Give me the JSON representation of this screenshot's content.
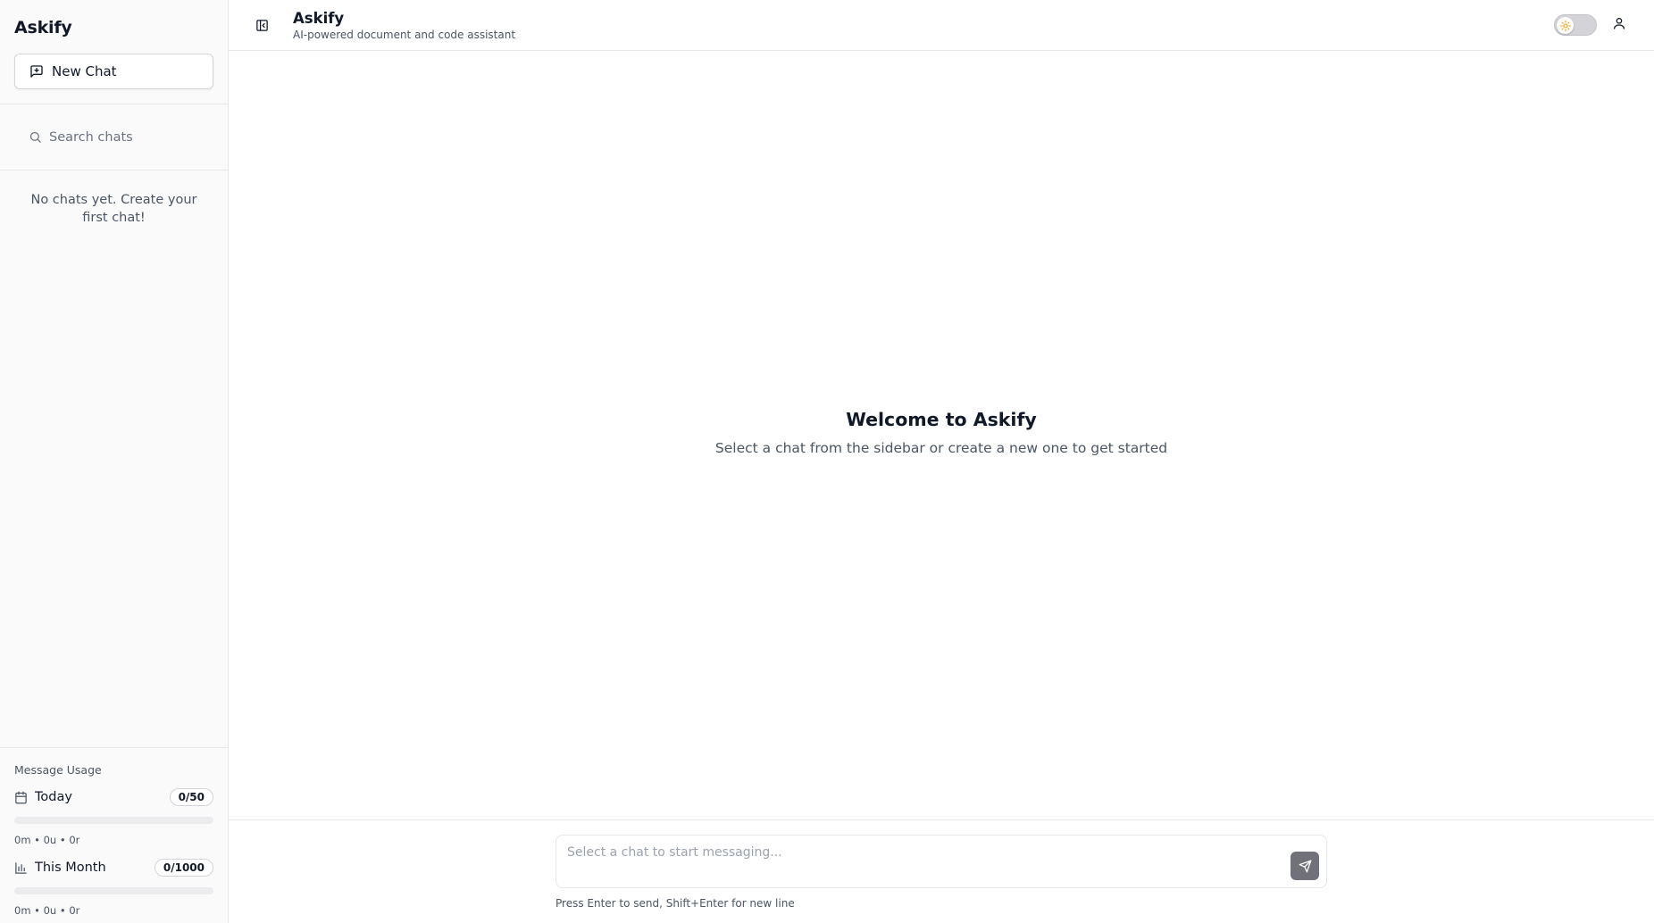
{
  "sidebar": {
    "brand": "Askify",
    "new_chat_label": "New Chat",
    "search_placeholder": "Search chats",
    "empty_text": "No chats yet. Create your first chat!",
    "usage": {
      "title": "Message Usage",
      "today": {
        "label": "Today",
        "badge": "0/50",
        "progress_percent": 0,
        "stats": "0m • 0u • 0r"
      },
      "month": {
        "label": "This Month",
        "badge": "0/1000",
        "progress_percent": 0,
        "stats": "0m • 0u • 0r"
      }
    }
  },
  "header": {
    "title": "Askify",
    "subtitle": "AI-powered document and code assistant",
    "theme": "light"
  },
  "welcome": {
    "title": "Welcome to Askify",
    "subtitle": "Select a chat from the sidebar or create a new one to get started"
  },
  "composer": {
    "placeholder": "Select a chat to start messaging...",
    "value": "",
    "hint": "Press Enter to send, Shift+Enter for new line"
  },
  "icons": {
    "new_chat": "message-plus-icon",
    "search": "search-icon",
    "sidebar_toggle": "panel-left-icon",
    "theme": "sun-icon",
    "user": "user-icon",
    "today": "calendar-icon",
    "month": "bar-chart-icon",
    "send": "send-icon"
  },
  "colors": {
    "accent_sun": "#f59e0b",
    "send_button": "#71717a",
    "border": "#e5e7eb",
    "sidebar_bg": "#fafafa"
  }
}
